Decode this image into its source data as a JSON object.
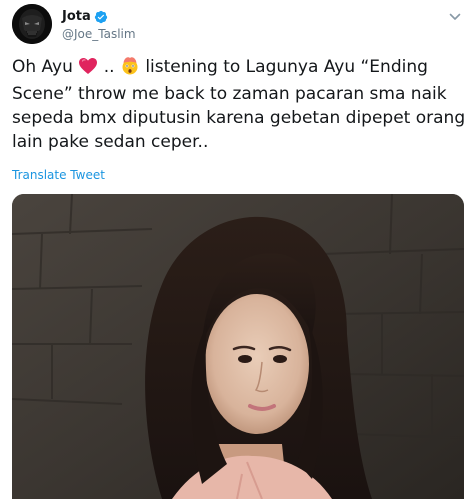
{
  "author": {
    "display_name": "Jota",
    "handle": "@Joe_Taslim",
    "verified": true,
    "avatar_icon": "dark-mask-avatar"
  },
  "tweet": {
    "segments": [
      "Oh Ayu",
      "..",
      "listening to Lagunya Ayu “Ending Scene” throw me back to zaman pacaran sma naik sepeda bmx diputusin karena gebetan dipepet orang lain pake sedan ceper.."
    ],
    "emoji": [
      "red-heart-emoji",
      "exploding-head-emoji"
    ],
    "translate_label": "Translate Tweet"
  },
  "media": {
    "description_icon": "photo-woman-dark-hair"
  },
  "colors": {
    "link": "#1b95e0",
    "verified": "#1da1f2",
    "secondary_text": "#657786",
    "heart": "#e0245e"
  }
}
